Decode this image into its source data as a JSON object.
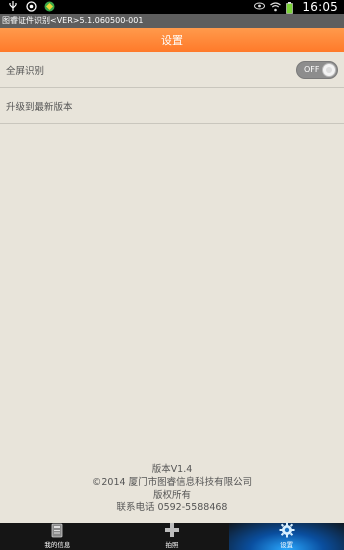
{
  "status_bar": {
    "time": "16:05",
    "icons": [
      "usb-icon",
      "sync-icon",
      "app-icon",
      "eye-icon",
      "wifi-icon",
      "battery-icon"
    ],
    "battery_color": "#7bd338"
  },
  "window_title": "图睿证件识别<VER>5.1.060500-001",
  "header": {
    "title": "设置",
    "color": "#ff8a3a"
  },
  "settings": {
    "fullscreen_label": "全屏识别",
    "toggle_state": "OFF",
    "upgrade_label": "升级到最新版本"
  },
  "footer": {
    "version": "版本V1.4",
    "copyright": "©2014 厦门市图睿信息科技有限公司",
    "rights": "版权所有",
    "contact": "联系电话 0592-5588468"
  },
  "bottom_nav": {
    "items": [
      {
        "label": "我的信息",
        "icon": "id-card-icon"
      },
      {
        "label": "拍照",
        "icon": "plus-icon"
      },
      {
        "label": "设置",
        "icon": "gear-icon"
      }
    ],
    "active_index": 2,
    "active_color": "#2aa9ff"
  }
}
